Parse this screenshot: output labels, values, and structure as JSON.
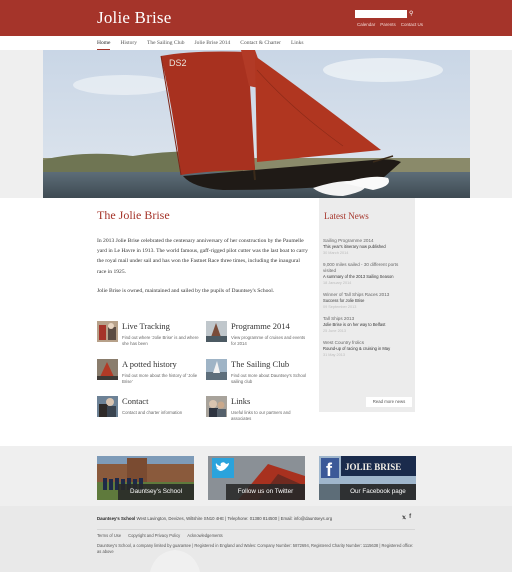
{
  "header": {
    "site_title": "Jolie Brise",
    "search_placeholder": "",
    "top_links": [
      "Calendar",
      "Parents",
      "Contact Us"
    ]
  },
  "nav": {
    "items": [
      "Home",
      "History",
      "The Sailing Club",
      "Jolie Brise 2014",
      "Contact & Charter",
      "Links"
    ],
    "active": "Home"
  },
  "hero": {
    "sail_number": "DS2"
  },
  "main": {
    "heading": "The Jolie Brise",
    "paragraphs": [
      "In 2013 Jolie Brise celebrated the centenary anniversary of her construction by the Paumelle yard in Le Havre in 1913. The world famous, gaff-rigged pilot cutter was the last boat to carry the royal mail under sail and has won the Fastnet Race three times, including the inaugural race in 1925.",
      "Jolie Brise is owned, maintained and sailed by the pupils of Dauntsey's School."
    ],
    "tiles": [
      {
        "title": "Live Tracking",
        "desc": "Find out where 'Jolie Brise' is and where she has been",
        "icon": "tracking-icon"
      },
      {
        "title": "Programme 2014",
        "desc": "View programme of cruises and events for 2014",
        "icon": "programme-icon"
      },
      {
        "title": "A potted history",
        "desc": "Find out more about the history of 'Jolie Brise'",
        "icon": "history-icon"
      },
      {
        "title": "The Sailing Club",
        "desc": "Find out more about Dauntsey's School sailing club",
        "icon": "sailing-club-icon"
      },
      {
        "title": "Contact",
        "desc": "Contact and charter information",
        "icon": "contact-icon"
      },
      {
        "title": "Links",
        "desc": "Useful links to our partners and associates",
        "icon": "links-icon"
      }
    ]
  },
  "sidebar": {
    "title": "Latest News",
    "news": [
      {
        "title": "Sailing Programme 2014",
        "sub": "This year's itinerary now published",
        "date": "30 March 2014"
      },
      {
        "title": "9,000 miles sailed - 30 different ports visited",
        "sub": "A summary of the 2013 Sailing Season",
        "date": "18 January 2014"
      },
      {
        "title": "Winner of Tall Ships Races 2013",
        "sub": "Success for Jolie Brise",
        "date": "09 September 2013"
      },
      {
        "title": "Tall Ships 2013",
        "sub": "Jolie Brise is on her way to Belfast",
        "date": "25 June 2013"
      },
      {
        "title": "West Country frolics",
        "sub": "Round-up of racing & cruising in May",
        "date": "31 May 2013"
      }
    ],
    "read_more": "Read more news"
  },
  "promos": [
    {
      "label": "Dauntsey's School"
    },
    {
      "label": "Follow us on Twitter"
    },
    {
      "label": "Our Facebook page",
      "banner_text": "JOLIE BRISE"
    }
  ],
  "footer": {
    "school_name": "Dauntsey's School",
    "address": "West Lavington, Devizes, Wiltshire SN10 4HE | Telephone: 01380 814500 | Email: info@dauntseys.org",
    "links": [
      "Terms of Use",
      "Copyright and Privacy Policy",
      "Acknowledgements"
    ],
    "legal": "Dauntsey's School, a company limited by guarantee | Registered in England and Wales: Company Number: 5872694, Registered Charity Number: 1115638 | Registered office: as above",
    "social": [
      "twitter-icon",
      "facebook-icon"
    ]
  },
  "colors": {
    "brand_red": "#a5342a",
    "sail_red": "#a8311f",
    "light_grey": "#efefef"
  }
}
